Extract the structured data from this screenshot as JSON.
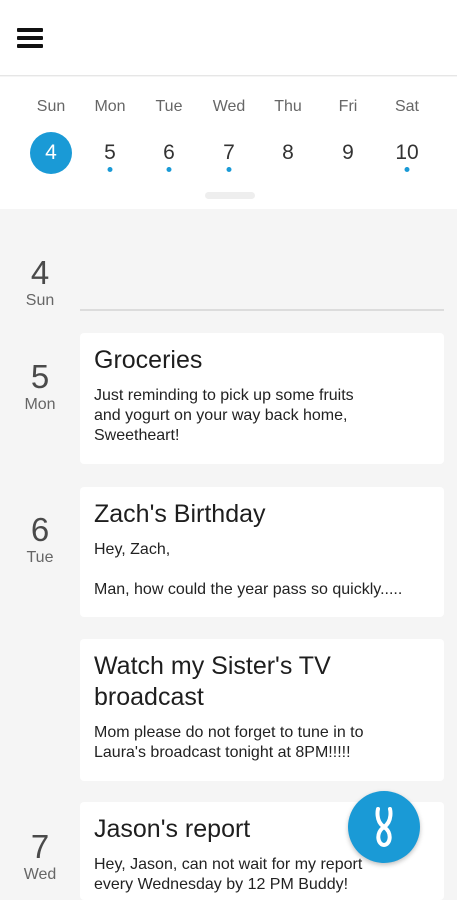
{
  "colors": {
    "accent": "#1a9ad6"
  },
  "week": {
    "days": [
      {
        "name": "Sun",
        "num": "4",
        "selected": true,
        "dot": false
      },
      {
        "name": "Mon",
        "num": "5",
        "selected": false,
        "dot": true
      },
      {
        "name": "Tue",
        "num": "6",
        "selected": false,
        "dot": true
      },
      {
        "name": "Wed",
        "num": "7",
        "selected": false,
        "dot": true
      },
      {
        "name": "Thu",
        "num": "8",
        "selected": false,
        "dot": false
      },
      {
        "name": "Fri",
        "num": "9",
        "selected": false,
        "dot": false
      },
      {
        "name": "Sat",
        "num": "10",
        "selected": false,
        "dot": true
      }
    ]
  },
  "agenda": {
    "dates": [
      {
        "num": "4",
        "weekday": "Sun"
      },
      {
        "num": "5",
        "weekday": "Mon"
      },
      {
        "num": "6",
        "weekday": "Tue"
      },
      {
        "num": "7",
        "weekday": "Wed"
      }
    ],
    "notes": [
      {
        "title": "Groceries",
        "body": "Just reminding to pick up some fruits\nand yogurt on your way back home,\nSweetheart!"
      },
      {
        "title": "Zach's Birthday",
        "body": "Hey, Zach,\n\nMan, how could the year pass so quickly....."
      },
      {
        "title": "Watch my Sister's TV\nbroadcast",
        "body": "Mom please do not forget to tune in to\nLaura's broadcast tonight at 8PM!!!!!"
      },
      {
        "title": "Jason's report",
        "body": "Hey, Jason, can not wait for my report\nevery Wednesday by 12 PM Buddy!"
      }
    ]
  },
  "fab": {
    "icon": "app-logo-icon"
  },
  "topbar": {
    "menu_icon": "hamburger-menu-icon"
  }
}
